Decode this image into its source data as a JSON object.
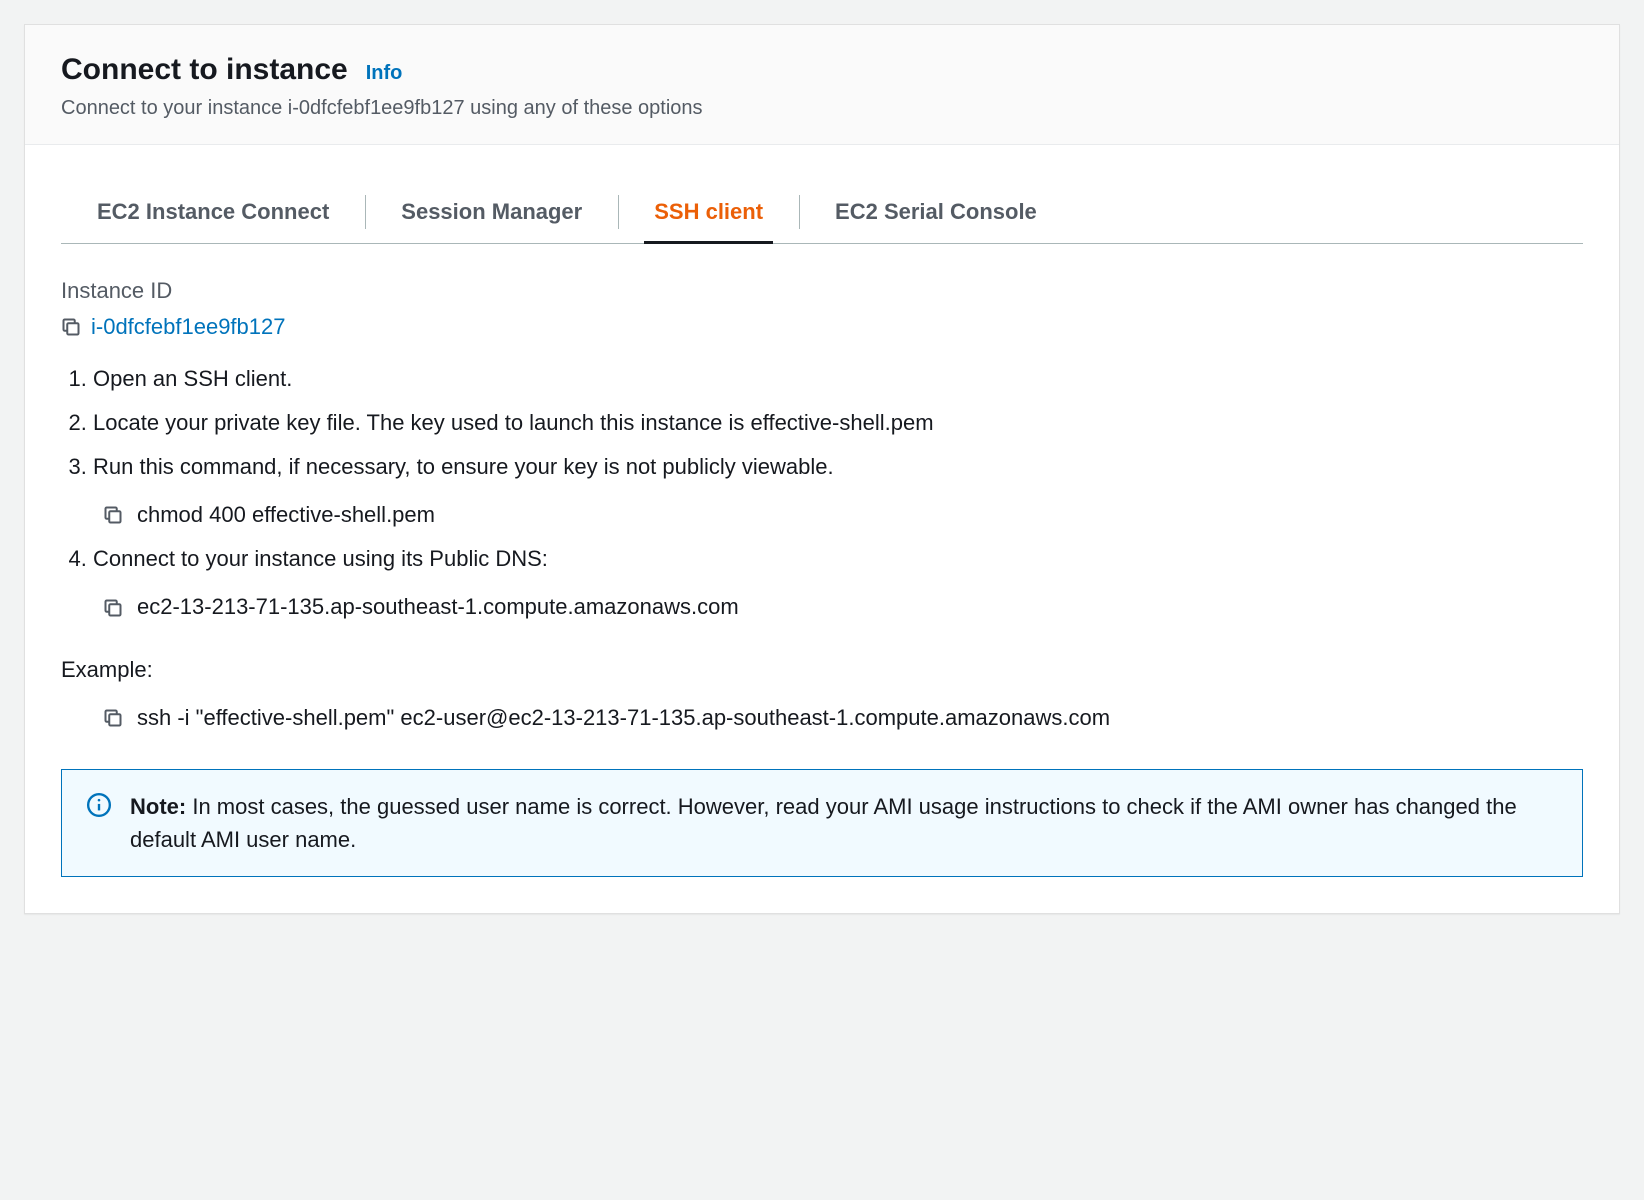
{
  "header": {
    "title": "Connect to instance",
    "info_label": "Info",
    "subtitle": "Connect to your instance i-0dfcfebf1ee9fb127 using any of these options"
  },
  "tabs": [
    {
      "label": "EC2 Instance Connect",
      "active": false
    },
    {
      "label": "Session Manager",
      "active": false
    },
    {
      "label": "SSH client",
      "active": true
    },
    {
      "label": "EC2 Serial Console",
      "active": false
    }
  ],
  "instance": {
    "label": "Instance ID",
    "id": "i-0dfcfebf1ee9fb127"
  },
  "steps": {
    "s1": "Open an SSH client.",
    "s2": "Locate your private key file. The key used to launch this instance is effective-shell.pem",
    "s3": "Run this command, if necessary, to ensure your key is not publicly viewable.",
    "s3_code": "chmod 400 effective-shell.pem",
    "s4": "Connect to your instance using its Public DNS:",
    "s4_code": "ec2-13-213-71-135.ap-southeast-1.compute.amazonaws.com"
  },
  "example": {
    "label": "Example:",
    "code": "ssh -i \"effective-shell.pem\" ec2-user@ec2-13-213-71-135.ap-southeast-1.compute.amazonaws.com"
  },
  "note": {
    "prefix": "Note:",
    "text": "In most cases, the guessed user name is correct. However, read your AMI usage instructions to check if the AMI owner has changed the default AMI user name."
  }
}
